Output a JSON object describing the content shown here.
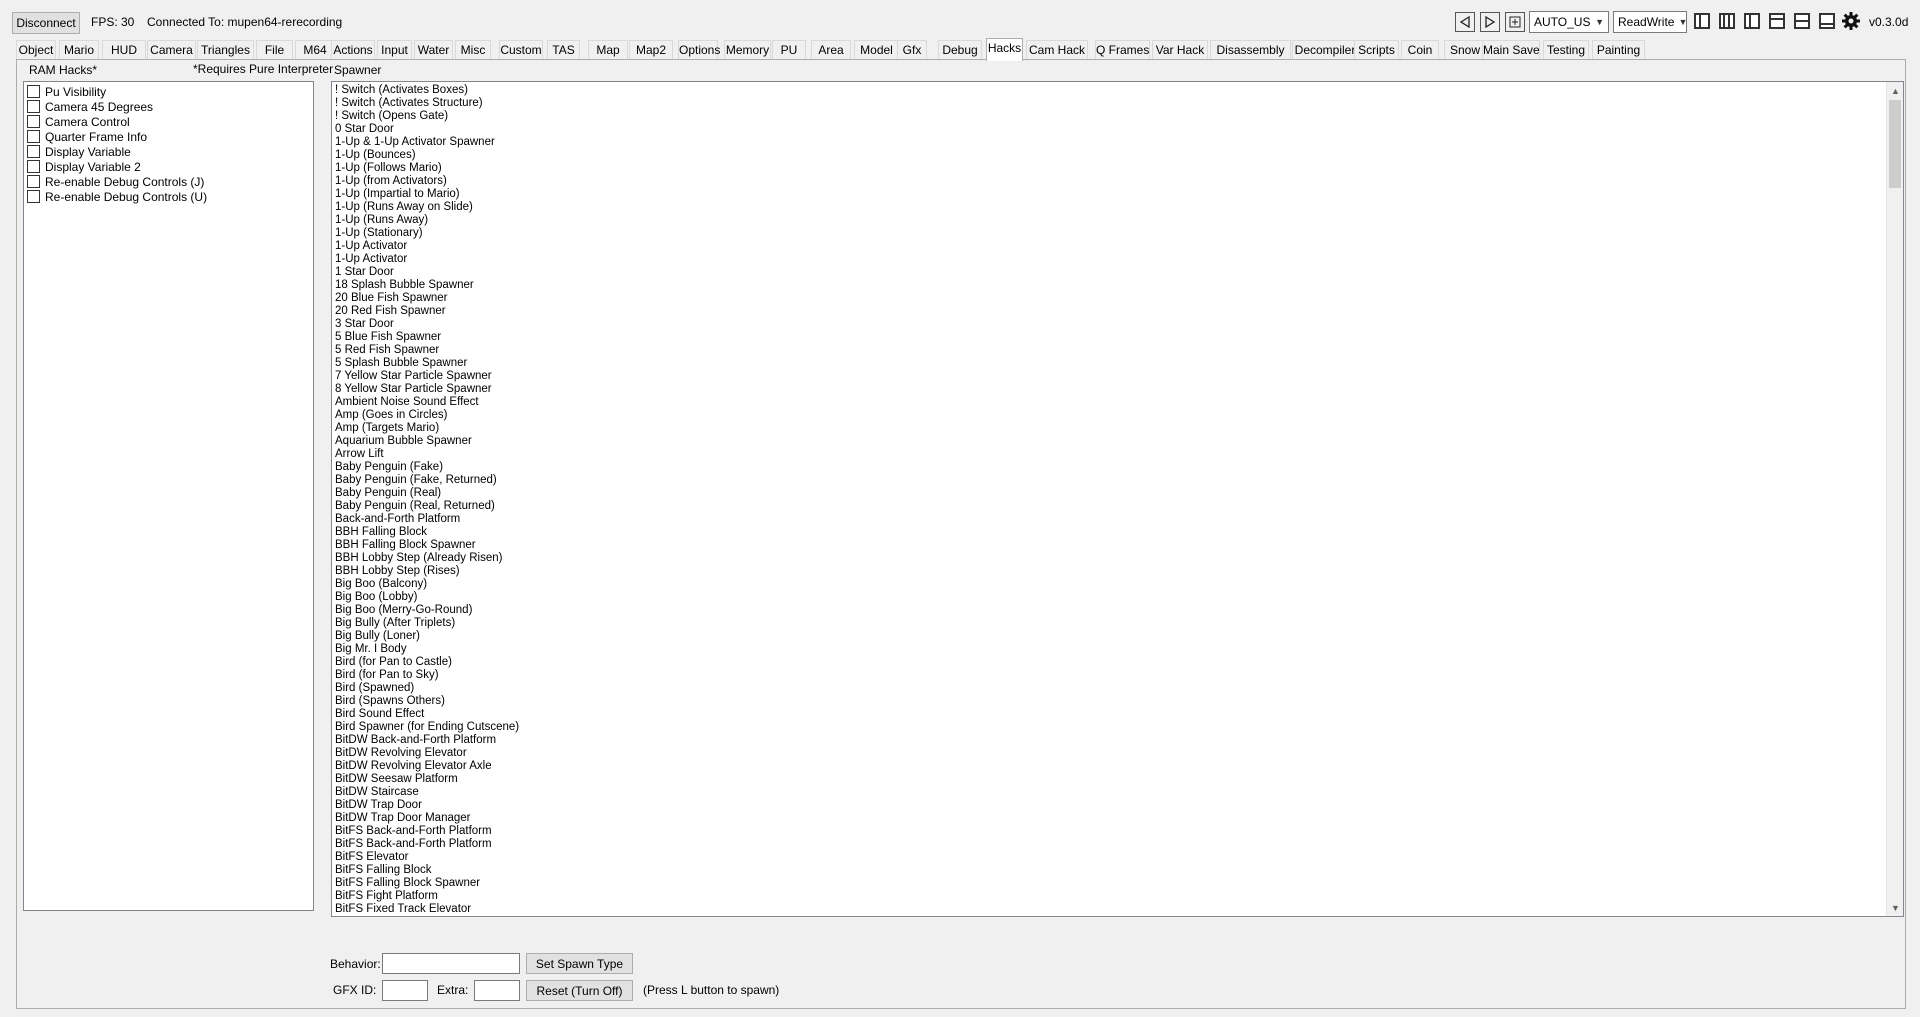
{
  "topbar": {
    "disconnect_label": "Disconnect",
    "fps": "FPS: 30",
    "connection": "Connected To: mupen64-rerecording",
    "region": "AUTO_US",
    "access": "ReadWrite",
    "version": "v0.3.0d",
    "icons": [
      "step-back-icon",
      "step-forward-icon",
      "add-icon",
      "layout-1-icon",
      "layout-2-icon",
      "layout-3-icon",
      "layout-4-icon",
      "layout-5-icon",
      "layout-6-icon",
      "gear-icon"
    ]
  },
  "tabs": [
    "Object",
    "Mario",
    "HUD",
    "Camera",
    "Triangles",
    "File",
    "M64",
    "Actions",
    "Input",
    "Water",
    "Misc",
    "Custom",
    "TAS",
    "Map",
    "Map2",
    "Options",
    "Memory",
    "PU",
    "Area",
    "Model",
    "Gfx",
    "Debug",
    "Hacks",
    "Cam Hack",
    "Q Frames",
    "Var Hack",
    "Disassembly",
    "Decompiler",
    "Scripts",
    "Coin",
    "Snow",
    "Main Save",
    "Testing",
    "Painting"
  ],
  "active_tab": "Hacks",
  "ram_hacks": {
    "title": "RAM Hacks*",
    "note": "*Requires Pure Interpreter",
    "items": [
      {
        "label": "Pu Visibility",
        "checked": false
      },
      {
        "label": "Camera 45 Degrees",
        "checked": false
      },
      {
        "label": "Camera Control",
        "checked": false
      },
      {
        "label": "Quarter Frame Info",
        "checked": false
      },
      {
        "label": "Display Variable",
        "checked": false
      },
      {
        "label": "Display Variable 2",
        "checked": false
      },
      {
        "label": "Re-enable Debug Controls (J)",
        "checked": false
      },
      {
        "label": "Re-enable Debug Controls (U)",
        "checked": false
      }
    ]
  },
  "spawner": {
    "title": "Spawner",
    "items": [
      "! Switch (Activates Boxes)",
      "! Switch (Activates Structure)",
      "! Switch (Opens Gate)",
      "0 Star Door",
      "1-Up & 1-Up Activator Spawner",
      "1-Up (Bounces)",
      "1-Up (Follows Mario)",
      "1-Up (from Activators)",
      "1-Up (Impartial to Mario)",
      "1-Up (Runs Away on Slide)",
      "1-Up (Runs Away)",
      "1-Up (Stationary)",
      "1-Up Activator",
      "1-Up Activator",
      "1 Star Door",
      "18 Splash Bubble Spawner",
      "20 Blue Fish Spawner",
      "20 Red Fish Spawner",
      "3 Star Door",
      "5 Blue Fish Spawner",
      "5 Red Fish Spawner",
      "5 Splash Bubble Spawner",
      "7 Yellow Star Particle Spawner",
      "8 Yellow Star Particle Spawner",
      "Ambient Noise Sound Effect",
      "Amp (Goes in Circles)",
      "Amp (Targets Mario)",
      "Aquarium Bubble Spawner",
      "Arrow Lift",
      "Baby Penguin (Fake)",
      "Baby Penguin (Fake, Returned)",
      "Baby Penguin (Real)",
      "Baby Penguin (Real, Returned)",
      "Back-and-Forth Platform",
      "BBH Falling Block",
      "BBH Falling Block Spawner",
      "BBH Lobby Step (Already Risen)",
      "BBH Lobby Step (Rises)",
      "Big Boo (Balcony)",
      "Big Boo (Lobby)",
      "Big Boo (Merry-Go-Round)",
      "Big Bully (After Triplets)",
      "Big Bully (Loner)",
      "Big Mr. I Body",
      "Bird (for Pan to Castle)",
      "Bird (for Pan to Sky)",
      "Bird (Spawned)",
      "Bird (Spawns Others)",
      "Bird Sound Effect",
      "Bird Spawner (for Ending Cutscene)",
      "BitDW Back-and-Forth Platform",
      "BitDW Revolving Elevator",
      "BitDW Revolving Elevator Axle",
      "BitDW Seesaw Platform",
      "BitDW Staircase",
      "BitDW Trap Door",
      "BitDW Trap Door Manager",
      "BitFS Back-and-Forth Platform",
      "BitFS Back-and-Forth Platform",
      "BitFS Elevator",
      "BitFS Falling Block",
      "BitFS Falling Block Spawner",
      "BitFS Fight Platform",
      "BitFS Fixed Track Elevator"
    ],
    "behavior_label": "Behavior:",
    "behavior_value": "",
    "set_spawn_label": "Set Spawn Type",
    "gfx_label": "GFX ID:",
    "gfx_value": "",
    "extra_label": "Extra:",
    "extra_value": "",
    "reset_label": "Reset (Turn Off)",
    "hint": "(Press L button to spawn)"
  }
}
